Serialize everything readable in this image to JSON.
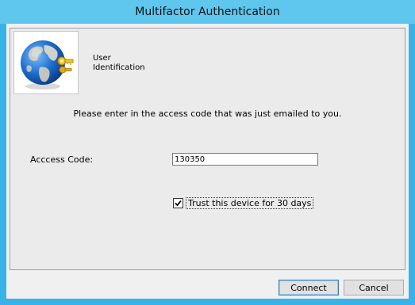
{
  "window": {
    "title": "Multifactor Authentication"
  },
  "header": {
    "line1": "User",
    "line2": "Identification"
  },
  "prompt": "Please enter in the access code that was just emailed to you.",
  "access_code": {
    "label": "Acccess Code:",
    "value": "130350"
  },
  "trust": {
    "label": "Trust this device for 30 days",
    "checked": true
  },
  "buttons": {
    "connect": "Connect",
    "cancel": "Cancel"
  },
  "icons": {
    "header": "globe-keys-icon",
    "check": "checkmark-icon"
  }
}
